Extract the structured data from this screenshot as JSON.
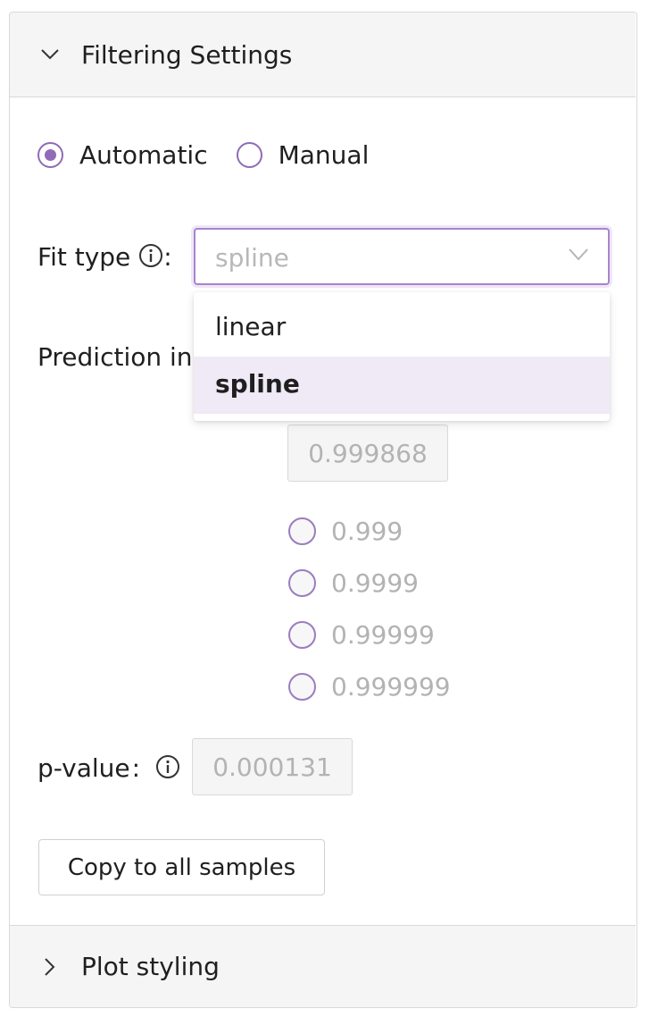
{
  "filtering_section": {
    "title": "Filtering Settings"
  },
  "mode": {
    "options": [
      {
        "label": "Automatic",
        "checked": true
      },
      {
        "label": "Manual",
        "checked": false
      }
    ]
  },
  "fit_type": {
    "label": "Fit type",
    "separator": ":",
    "selected": "spline",
    "options": [
      "linear",
      "spline"
    ]
  },
  "prediction_interval": {
    "label_visible": "Prediction in",
    "value": "0.999868",
    "options": [
      "0.999",
      "0.9999",
      "0.99999",
      "0.999999"
    ]
  },
  "p_value": {
    "label": "p-value",
    "separator": ":",
    "value": "0.000131"
  },
  "copy_button": {
    "label": "Copy to all samples"
  },
  "plot_section": {
    "title": "Plot styling"
  },
  "colors": {
    "accent": "#8f6bb8",
    "accent_light": "#f0e9f6",
    "border": "#d9d9d9",
    "header_bg": "#f5f5f5"
  },
  "icons": {
    "expanded": "chevron-down-icon",
    "collapsed": "chevron-right-icon",
    "info": "info-icon",
    "select": "chevron-down-icon"
  }
}
